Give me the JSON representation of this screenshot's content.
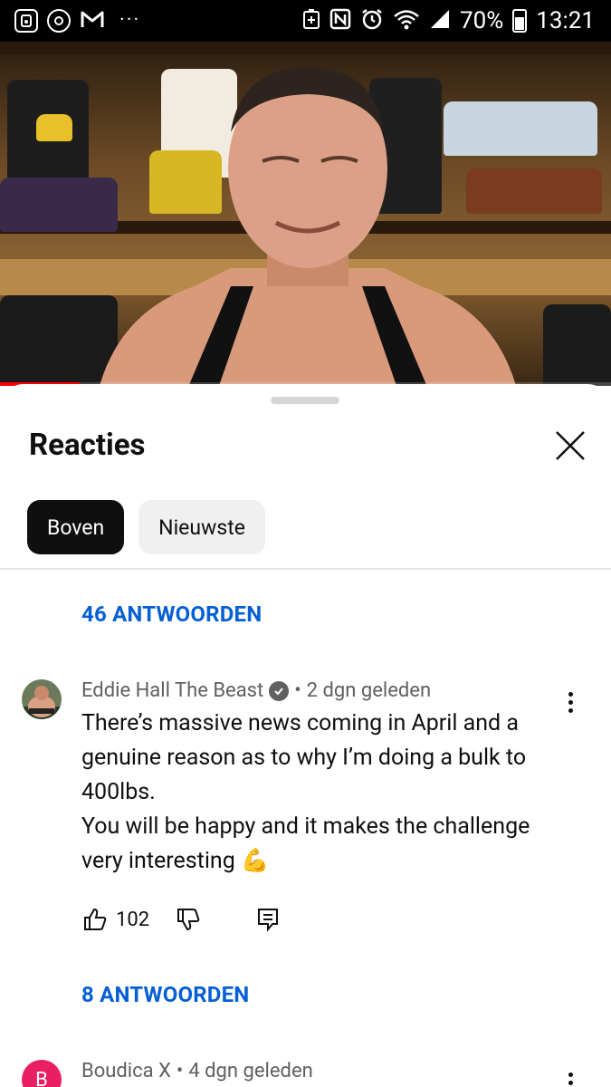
{
  "status_bar": {
    "left_icons": [
      "signal-notification-icon",
      "camera-notification-icon",
      "gmail-icon"
    ],
    "more_dots": "···",
    "battery_percent": "70%",
    "time": "13:21"
  },
  "video": {
    "progress": 0.13
  },
  "sheet": {
    "title": "Reacties",
    "chips": [
      {
        "label": "Boven",
        "active": true
      },
      {
        "label": "Nieuwste",
        "active": false
      }
    ]
  },
  "comments": {
    "top_replies_link": "46 ANTWOORDEN",
    "items": [
      {
        "author": "Eddie Hall The Beast",
        "verified": true,
        "separator": "•",
        "time": "2 dgn geleden",
        "lines": [
          "There’s massive news coming in April and a",
          "genuine reason as to why I’m doing a bulk to",
          "400lbs.",
          "You will be happy and it makes the challenge",
          "very interesting 💪"
        ],
        "likes": "102",
        "replies_link": "8 ANTWOORDEN"
      },
      {
        "author": "Boudica X",
        "avatar_letter": "B",
        "separator": "•",
        "time": "4 dgn geleden"
      }
    ]
  },
  "colors": {
    "accent_link": "#065fd4",
    "avatar_b": "#e91e63"
  }
}
